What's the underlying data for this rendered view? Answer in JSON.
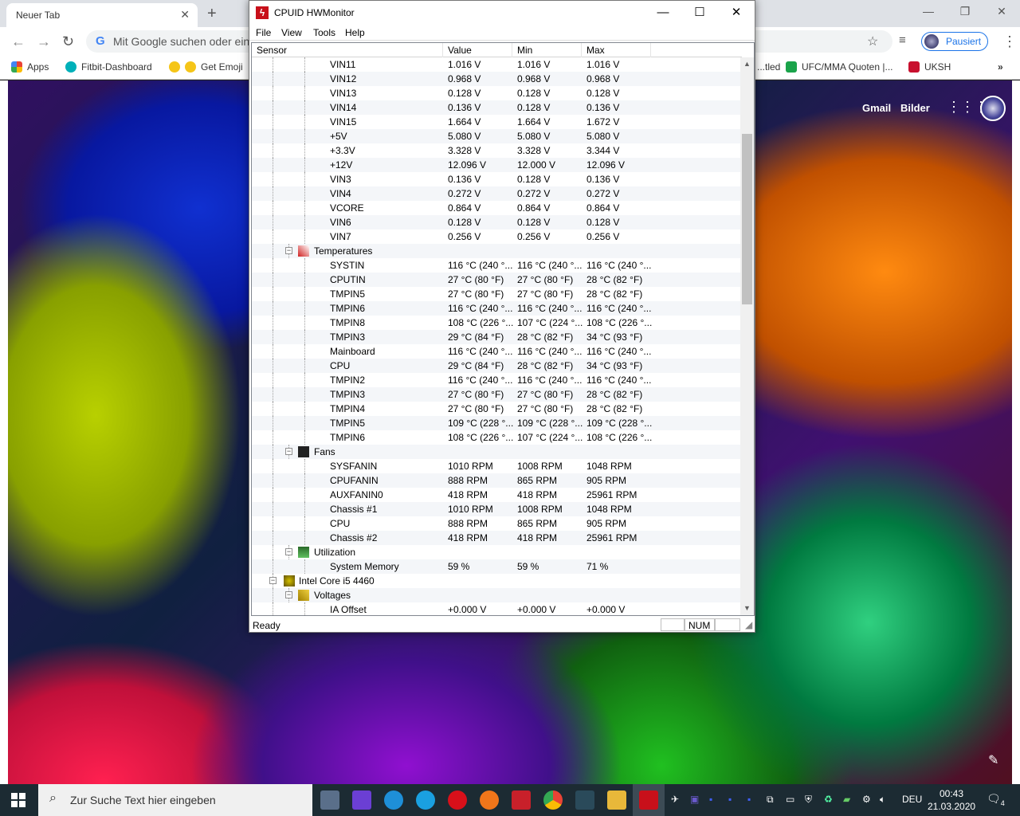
{
  "browser": {
    "tab_title": "Neuer Tab",
    "omnibox_placeholder": "Mit Google suchen oder eine URL eingeben",
    "profile_label": "Pausiert",
    "bookmarks": [
      "Apps",
      "Fitbit-Dashboard",
      "Get Emoji",
      "...tled",
      "UFC/MMA Quoten |...",
      "UKSH"
    ],
    "header_links": [
      "Gmail",
      "Bilder"
    ]
  },
  "hwmonitor": {
    "title": "CPUID HWMonitor",
    "menu": [
      "File",
      "View",
      "Tools",
      "Help"
    ],
    "columns": [
      "Sensor",
      "Value",
      "Min",
      "Max"
    ],
    "rows": [
      {
        "name": "VIN11",
        "value": "1.016 V",
        "min": "1.016 V",
        "max": "1.016 V",
        "level": 3
      },
      {
        "name": "VIN12",
        "value": "0.968 V",
        "min": "0.968 V",
        "max": "0.968 V",
        "level": 3
      },
      {
        "name": "VIN13",
        "value": "0.128 V",
        "min": "0.128 V",
        "max": "0.128 V",
        "level": 3
      },
      {
        "name": "VIN14",
        "value": "0.136 V",
        "min": "0.128 V",
        "max": "0.136 V",
        "level": 3
      },
      {
        "name": "VIN15",
        "value": "1.664 V",
        "min": "1.664 V",
        "max": "1.672 V",
        "level": 3
      },
      {
        "name": "+5V",
        "value": "5.080 V",
        "min": "5.080 V",
        "max": "5.080 V",
        "level": 3
      },
      {
        "name": "+3.3V",
        "value": "3.328 V",
        "min": "3.328 V",
        "max": "3.344 V",
        "level": 3
      },
      {
        "name": "+12V",
        "value": "12.096 V",
        "min": "12.000 V",
        "max": "12.096 V",
        "level": 3
      },
      {
        "name": "VIN3",
        "value": "0.136 V",
        "min": "0.128 V",
        "max": "0.136 V",
        "level": 3
      },
      {
        "name": "VIN4",
        "value": "0.272 V",
        "min": "0.272 V",
        "max": "0.272 V",
        "level": 3
      },
      {
        "name": "VCORE",
        "value": "0.864 V",
        "min": "0.864 V",
        "max": "0.864 V",
        "level": 3
      },
      {
        "name": "VIN6",
        "value": "0.128 V",
        "min": "0.128 V",
        "max": "0.128 V",
        "level": 3
      },
      {
        "name": "VIN7",
        "value": "0.256 V",
        "min": "0.256 V",
        "max": "0.256 V",
        "level": 3
      },
      {
        "name": "Temperatures",
        "value": "",
        "min": "",
        "max": "",
        "level": 2,
        "icon": "thermometer-icon"
      },
      {
        "name": "SYSTIN",
        "value": "116 °C  (240 °...",
        "min": "116 °C  (240 °...",
        "max": "116 °C  (240 °...",
        "level": 3
      },
      {
        "name": "CPUTIN",
        "value": "27 °C  (80 °F)",
        "min": "27 °C  (80 °F)",
        "max": "28 °C  (82 °F)",
        "level": 3
      },
      {
        "name": "TMPIN5",
        "value": "27 °C  (80 °F)",
        "min": "27 °C  (80 °F)",
        "max": "28 °C  (82 °F)",
        "level": 3
      },
      {
        "name": "TMPIN6",
        "value": "116 °C  (240 °...",
        "min": "116 °C  (240 °...",
        "max": "116 °C  (240 °...",
        "level": 3
      },
      {
        "name": "TMPIN8",
        "value": "108 °C  (226 °...",
        "min": "107 °C  (224 °...",
        "max": "108 °C  (226 °...",
        "level": 3
      },
      {
        "name": "TMPIN3",
        "value": "29 °C  (84 °F)",
        "min": "28 °C  (82 °F)",
        "max": "34 °C  (93 °F)",
        "level": 3
      },
      {
        "name": "Mainboard",
        "value": "116 °C  (240 °...",
        "min": "116 °C  (240 °...",
        "max": "116 °C  (240 °...",
        "level": 3
      },
      {
        "name": "CPU",
        "value": "29 °C  (84 °F)",
        "min": "28 °C  (82 °F)",
        "max": "34 °C  (93 °F)",
        "level": 3
      },
      {
        "name": "TMPIN2",
        "value": "116 °C  (240 °...",
        "min": "116 °C  (240 °...",
        "max": "116 °C  (240 °...",
        "level": 3
      },
      {
        "name": "TMPIN3",
        "value": "27 °C  (80 °F)",
        "min": "27 °C  (80 °F)",
        "max": "28 °C  (82 °F)",
        "level": 3
      },
      {
        "name": "TMPIN4",
        "value": "27 °C  (80 °F)",
        "min": "27 °C  (80 °F)",
        "max": "28 °C  (82 °F)",
        "level": 3
      },
      {
        "name": "TMPIN5",
        "value": "109 °C  (228 °...",
        "min": "109 °C  (228 °...",
        "max": "109 °C  (228 °...",
        "level": 3
      },
      {
        "name": "TMPIN6",
        "value": "108 °C  (226 °...",
        "min": "107 °C  (224 °...",
        "max": "108 °C  (226 °...",
        "level": 3
      },
      {
        "name": "Fans",
        "value": "",
        "min": "",
        "max": "",
        "level": 2,
        "icon": "fan-icon"
      },
      {
        "name": "SYSFANIN",
        "value": "1010 RPM",
        "min": "1008 RPM",
        "max": "1048 RPM",
        "level": 3
      },
      {
        "name": "CPUFANIN",
        "value": "888 RPM",
        "min": "865 RPM",
        "max": "905 RPM",
        "level": 3
      },
      {
        "name": "AUXFANIN0",
        "value": "418 RPM",
        "min": "418 RPM",
        "max": "25961 RPM",
        "level": 3
      },
      {
        "name": "Chassis #1",
        "value": "1010 RPM",
        "min": "1008 RPM",
        "max": "1048 RPM",
        "level": 3
      },
      {
        "name": "CPU",
        "value": "888 RPM",
        "min": "865 RPM",
        "max": "905 RPM",
        "level": 3
      },
      {
        "name": "Chassis #2",
        "value": "418 RPM",
        "min": "418 RPM",
        "max": "25961 RPM",
        "level": 3
      },
      {
        "name": "Utilization",
        "value": "",
        "min": "",
        "max": "",
        "level": 2,
        "icon": "utilization-icon"
      },
      {
        "name": "System Memory",
        "value": "59 %",
        "min": "59 %",
        "max": "71 %",
        "level": 3
      },
      {
        "name": "Intel Core i5 4460",
        "value": "",
        "min": "",
        "max": "",
        "level": 1,
        "icon": "cpu-chip-icon"
      },
      {
        "name": "Voltages",
        "value": "",
        "min": "",
        "max": "",
        "level": 2,
        "icon": "voltage-icon"
      },
      {
        "name": "IA Offset",
        "value": "+0.000 V",
        "min": "+0.000 V",
        "max": "+0.000 V",
        "level": 3
      }
    ],
    "status": "Ready",
    "num_indicator": "NUM"
  },
  "taskbar": {
    "search_placeholder": "Zur Suche Text hier eingeben",
    "language": "DEU",
    "time": "00:43",
    "date": "21.03.2020",
    "notifications": "4"
  }
}
